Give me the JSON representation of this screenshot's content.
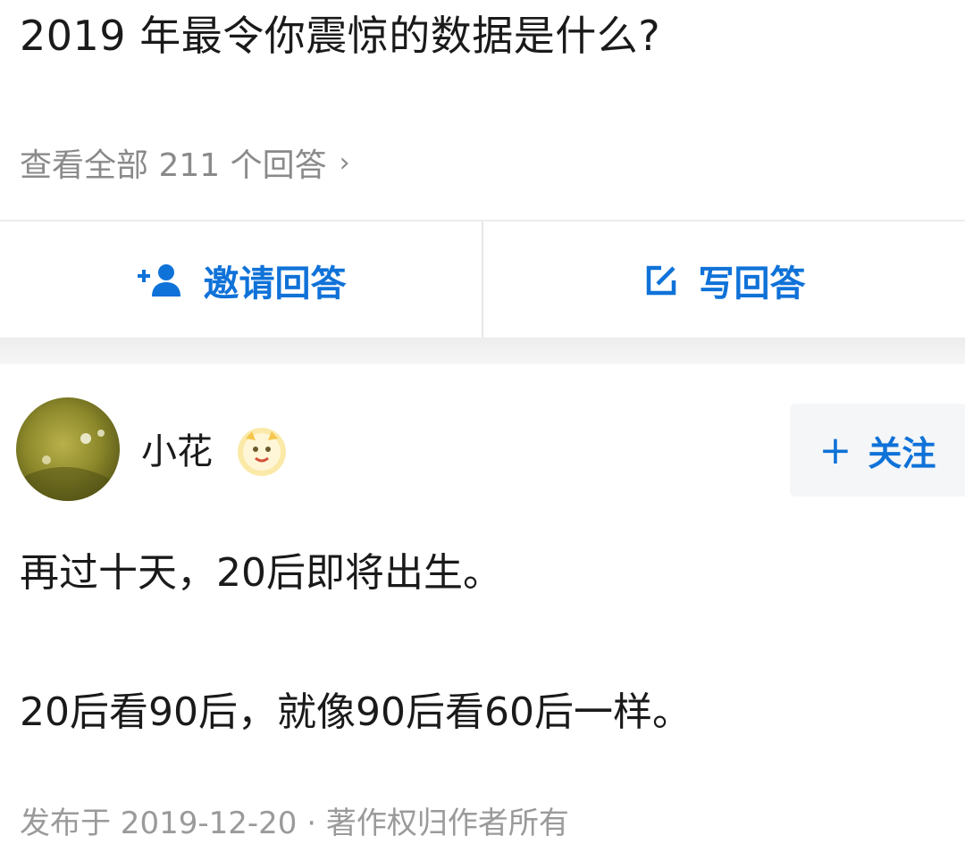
{
  "question": {
    "title": "2019 年最令你震惊的数据是什么?",
    "view_all": "查看全部 211 个回答",
    "chevron": "›"
  },
  "actions": {
    "invite_label": "邀请回答",
    "write_label": "写回答",
    "invite_icon": "add-user-icon",
    "write_icon": "edit-icon"
  },
  "answer": {
    "author": "小花",
    "follow_plus": "+",
    "follow_label": "关注",
    "paragraphs": [
      "再过十天，20后即将出生。",
      "20后看90后，就像90后看60后一样。"
    ],
    "meta": "发布于 2019-12-20 · 著作权归作者所有"
  },
  "colors": {
    "accent": "#0f72d8",
    "muted": "#8a8a8a",
    "text": "#1a1a1a"
  }
}
